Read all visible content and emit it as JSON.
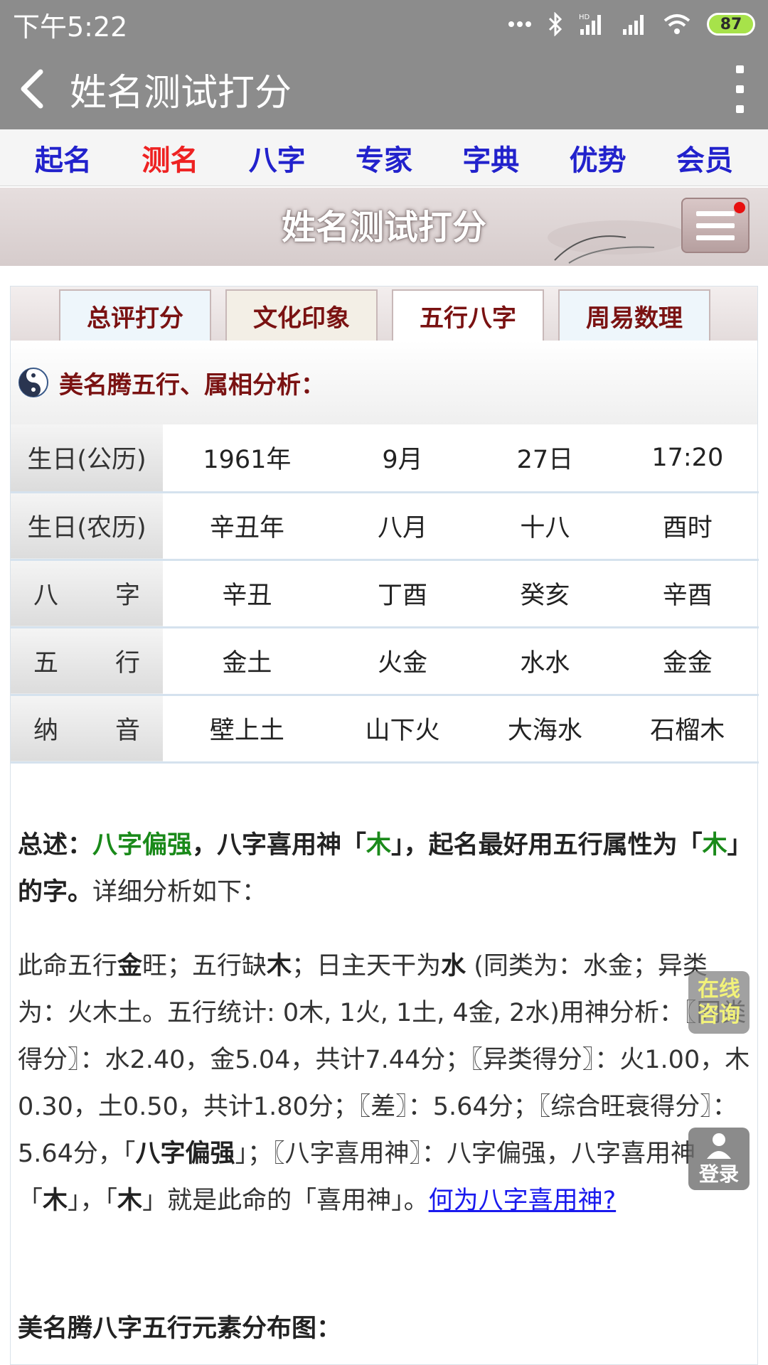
{
  "status": {
    "time": "下午5:22",
    "battery": "87"
  },
  "appbar": {
    "title": "姓名测试打分"
  },
  "nav": [
    "起名",
    "测名",
    "八字",
    "专家",
    "字典",
    "优势",
    "会员"
  ],
  "banner": {
    "title": "姓名测试打分"
  },
  "tabs": [
    "总评打分",
    "文化印象",
    "五行八字",
    "周易数理"
  ],
  "section": {
    "title": "美名腾五行、属相分析："
  },
  "table": {
    "rows": [
      {
        "label": "生日(公历)",
        "cells": [
          "1961年",
          "9月",
          "27日",
          "17:20"
        ]
      },
      {
        "label_a": "生日(农历)",
        "cells": [
          "辛丑年",
          "八月",
          "十八",
          "酉时"
        ]
      },
      {
        "label_a": "八",
        "label_b": "字",
        "cells": [
          "辛丑",
          "丁酉",
          "癸亥",
          "辛酉"
        ]
      },
      {
        "label_a": "五",
        "label_b": "行",
        "cells": [
          "金土",
          "火金",
          "水水",
          "金金"
        ]
      },
      {
        "label_a": "纳",
        "label_b": "音",
        "cells": [
          "壁上土",
          "山下火",
          "大海水",
          "石榴木"
        ]
      }
    ]
  },
  "summary": {
    "lead": "总述：",
    "strong": "八字偏强",
    "mid": "，八字喜用神「",
    "wood1": "木",
    "mid2": "」，起名最好用五行属性为「",
    "wood2": "木",
    "end": "」的字。",
    "tail": "详细分析如下："
  },
  "detail": {
    "p1": "此命五行",
    "jin": "金",
    "p2": "旺；五行缺",
    "mu": "木",
    "p3": "；日主天干为",
    "shui": "水",
    "p4": " (同类为：水金；异类为：火木土。五行统计: 0木, 1火, 1土, 4金, 2水)用神分析：〖同类得分〗：水2.40，金5.04，共计7.44分；〖异类得分〗：火1.00，木0.30，土0.50，共计1.80分；〖差〗：5.64分；〖综合旺衰得分〗：5.64分，「",
    "qiang": "八字偏强",
    "p5": "」；〖八字喜用神〗：八字偏强，八字喜用神「",
    "mu2": "木",
    "p6": "」，「",
    "mu3": "木",
    "p7": "」就是此命的「喜用神」。",
    "link": "何为八字喜用神?"
  },
  "chart_heading": "美名腾八字五行元素分布图：",
  "float": {
    "consult_1": "在线",
    "consult_2": "咨询",
    "login": "登录"
  }
}
